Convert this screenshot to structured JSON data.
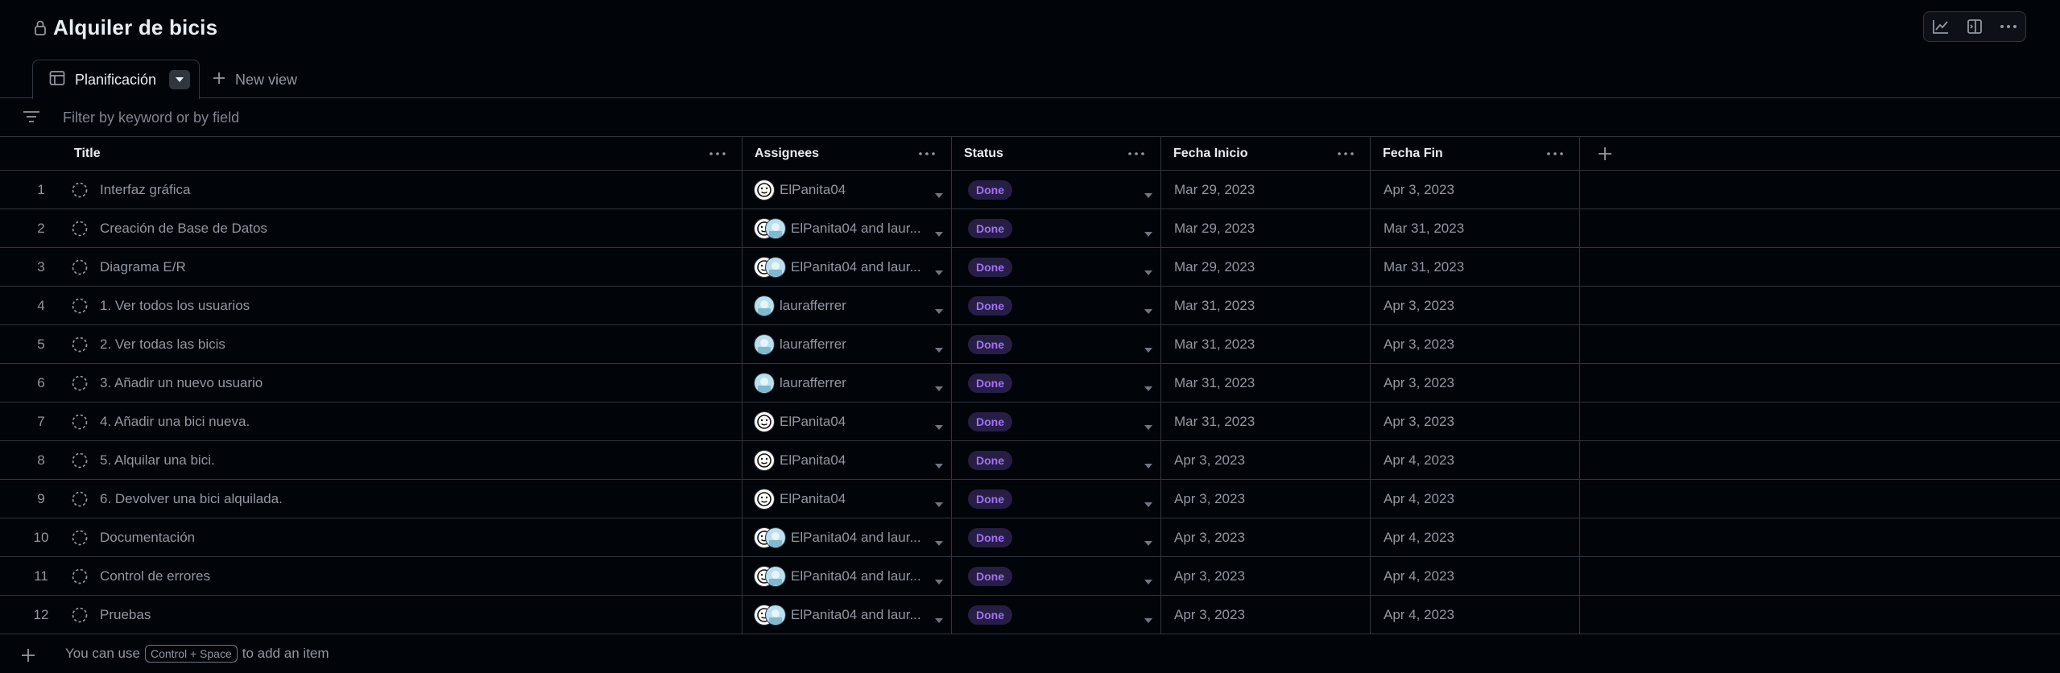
{
  "header": {
    "title": "Alquiler de bicis",
    "tools": [
      "insights-icon",
      "side-panel-icon",
      "more-icon"
    ]
  },
  "tabs": {
    "active_label": "Planificación",
    "new_view_label": "New view"
  },
  "filter": {
    "placeholder": "Filter by keyword or by field"
  },
  "columns": {
    "title": "Title",
    "assignees": "Assignees",
    "status": "Status",
    "start": "Fecha Inicio",
    "end": "Fecha Fin"
  },
  "rows": [
    {
      "num": "1",
      "title": "Interfaz gráfica",
      "assignees": "ElPanita04",
      "avatars": [
        "a1"
      ],
      "status": "Done",
      "start": "Mar 29, 2023",
      "end": "Apr 3, 2023"
    },
    {
      "num": "2",
      "title": "Creación de Base de Datos",
      "assignees": "ElPanita04 and laur...",
      "avatars": [
        "a1",
        "a2"
      ],
      "status": "Done",
      "start": "Mar 29, 2023",
      "end": "Mar 31, 2023"
    },
    {
      "num": "3",
      "title": "Diagrama E/R",
      "assignees": "ElPanita04 and laur...",
      "avatars": [
        "a1",
        "a2"
      ],
      "status": "Done",
      "start": "Mar 29, 2023",
      "end": "Mar 31, 2023"
    },
    {
      "num": "4",
      "title": "1. Ver todos los usuarios",
      "assignees": "laurafferrer",
      "avatars": [
        "a2"
      ],
      "status": "Done",
      "start": "Mar 31, 2023",
      "end": "Apr 3, 2023"
    },
    {
      "num": "5",
      "title": "2. Ver todas las bicis",
      "assignees": "laurafferrer",
      "avatars": [
        "a2"
      ],
      "status": "Done",
      "start": "Mar 31, 2023",
      "end": "Apr 3, 2023"
    },
    {
      "num": "6",
      "title": "3. Añadir un nuevo usuario",
      "assignees": "laurafferrer",
      "avatars": [
        "a2"
      ],
      "status": "Done",
      "start": "Mar 31, 2023",
      "end": "Apr 3, 2023"
    },
    {
      "num": "7",
      "title": "4. Añadir una bici nueva.",
      "assignees": "ElPanita04",
      "avatars": [
        "a1"
      ],
      "status": "Done",
      "start": "Mar 31, 2023",
      "end": "Apr 3, 2023"
    },
    {
      "num": "8",
      "title": "5. Alquilar una bici.",
      "assignees": "ElPanita04",
      "avatars": [
        "a1"
      ],
      "status": "Done",
      "start": "Apr 3, 2023",
      "end": "Apr 4, 2023"
    },
    {
      "num": "9",
      "title": "6. Devolver una bici alquilada.",
      "assignees": "ElPanita04",
      "avatars": [
        "a1"
      ],
      "status": "Done",
      "start": "Apr 3, 2023",
      "end": "Apr 4, 2023"
    },
    {
      "num": "10",
      "title": "Documentación",
      "assignees": "ElPanita04 and laur...",
      "avatars": [
        "a1",
        "a2"
      ],
      "status": "Done",
      "start": "Apr 3, 2023",
      "end": "Apr 4, 2023"
    },
    {
      "num": "11",
      "title": "Control de errores",
      "assignees": "ElPanita04 and laur...",
      "avatars": [
        "a1",
        "a2"
      ],
      "status": "Done",
      "start": "Apr 3, 2023",
      "end": "Apr 4, 2023"
    },
    {
      "num": "12",
      "title": "Pruebas",
      "assignees": "ElPanita04 and laur...",
      "avatars": [
        "a1",
        "a2"
      ],
      "status": "Done",
      "start": "Apr 3, 2023",
      "end": "Apr 4, 2023"
    }
  ],
  "footer": {
    "prefix": "You can use",
    "shortcut": "Control + Space",
    "suffix": "to add an item"
  },
  "colors": {
    "background": "#010409",
    "border": "#30363d",
    "done_badge_bg": "#271e45",
    "done_badge_text": "#a371f7"
  }
}
